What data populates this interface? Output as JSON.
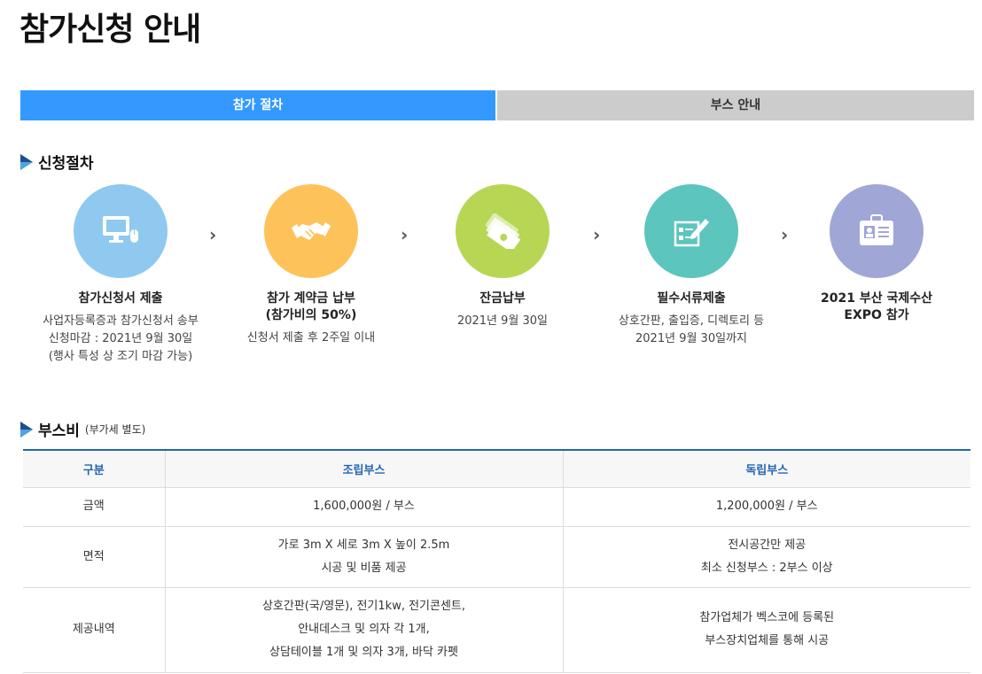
{
  "page": {
    "title": "참가신청 안내"
  },
  "tabs": [
    {
      "label": "참가 절차",
      "active": true
    },
    {
      "label": "부스 안내",
      "active": false
    }
  ],
  "procedure": {
    "heading": "신청절차",
    "steps": [
      {
        "icon": "monitor-icon",
        "color": "#8fc9ef",
        "title": "참가신청서 제출",
        "desc": [
          "사업자등록증과 참가신청서 송부",
          "신청마감 : 2021년 9월 30일",
          "(행사 특성 상 조기 마감 가능)"
        ]
      },
      {
        "icon": "handshake-icon",
        "color": "#fdc35a",
        "title": "참가 계약금 납부\n(참가비의 50%)",
        "desc": [
          "신청서 제출 후 2주일 이내"
        ]
      },
      {
        "icon": "money-icon",
        "color": "#b7d654",
        "title": "잔금납부",
        "desc": [
          "2021년 9월 30일"
        ]
      },
      {
        "icon": "document-pen-icon",
        "color": "#5cc5bd",
        "title": "필수서류제출",
        "desc": [
          "상호간판, 출입증, 디렉토리 등",
          "2021년 9월 30일까지"
        ]
      },
      {
        "icon": "id-badge-icon",
        "color": "#a0a6d6",
        "title": "2021 부산 국제수산\nEXPO 참가",
        "desc": []
      }
    ]
  },
  "booth_fee": {
    "heading": "부스비",
    "note": "(부가세 별도)",
    "columns": [
      "구분",
      "조립부스",
      "독립부스"
    ],
    "rows": [
      {
        "label": "금액",
        "assembled": [
          "1,600,000원 / 부스"
        ],
        "independent": [
          "1,200,000원 / 부스"
        ]
      },
      {
        "label": "면적",
        "assembled": [
          "가로 3m X 세로 3m X 높이 2.5m",
          "시공 및 비품 제공"
        ],
        "independent": [
          "전시공간만 제공",
          "최소 신청부스 : 2부스 이상"
        ]
      },
      {
        "label": "제공내역",
        "assembled": [
          "상호간판(국/영문), 전기1kw, 전기콘센트,",
          "안내데스크 및 의자 각 1개,",
          "상담테이블 1개 및 의자 3개, 바닥 카펫"
        ],
        "independent": [
          "참가업체가 벡스코에 등록된",
          "부스장치업체를 통해 시공"
        ]
      }
    ]
  }
}
